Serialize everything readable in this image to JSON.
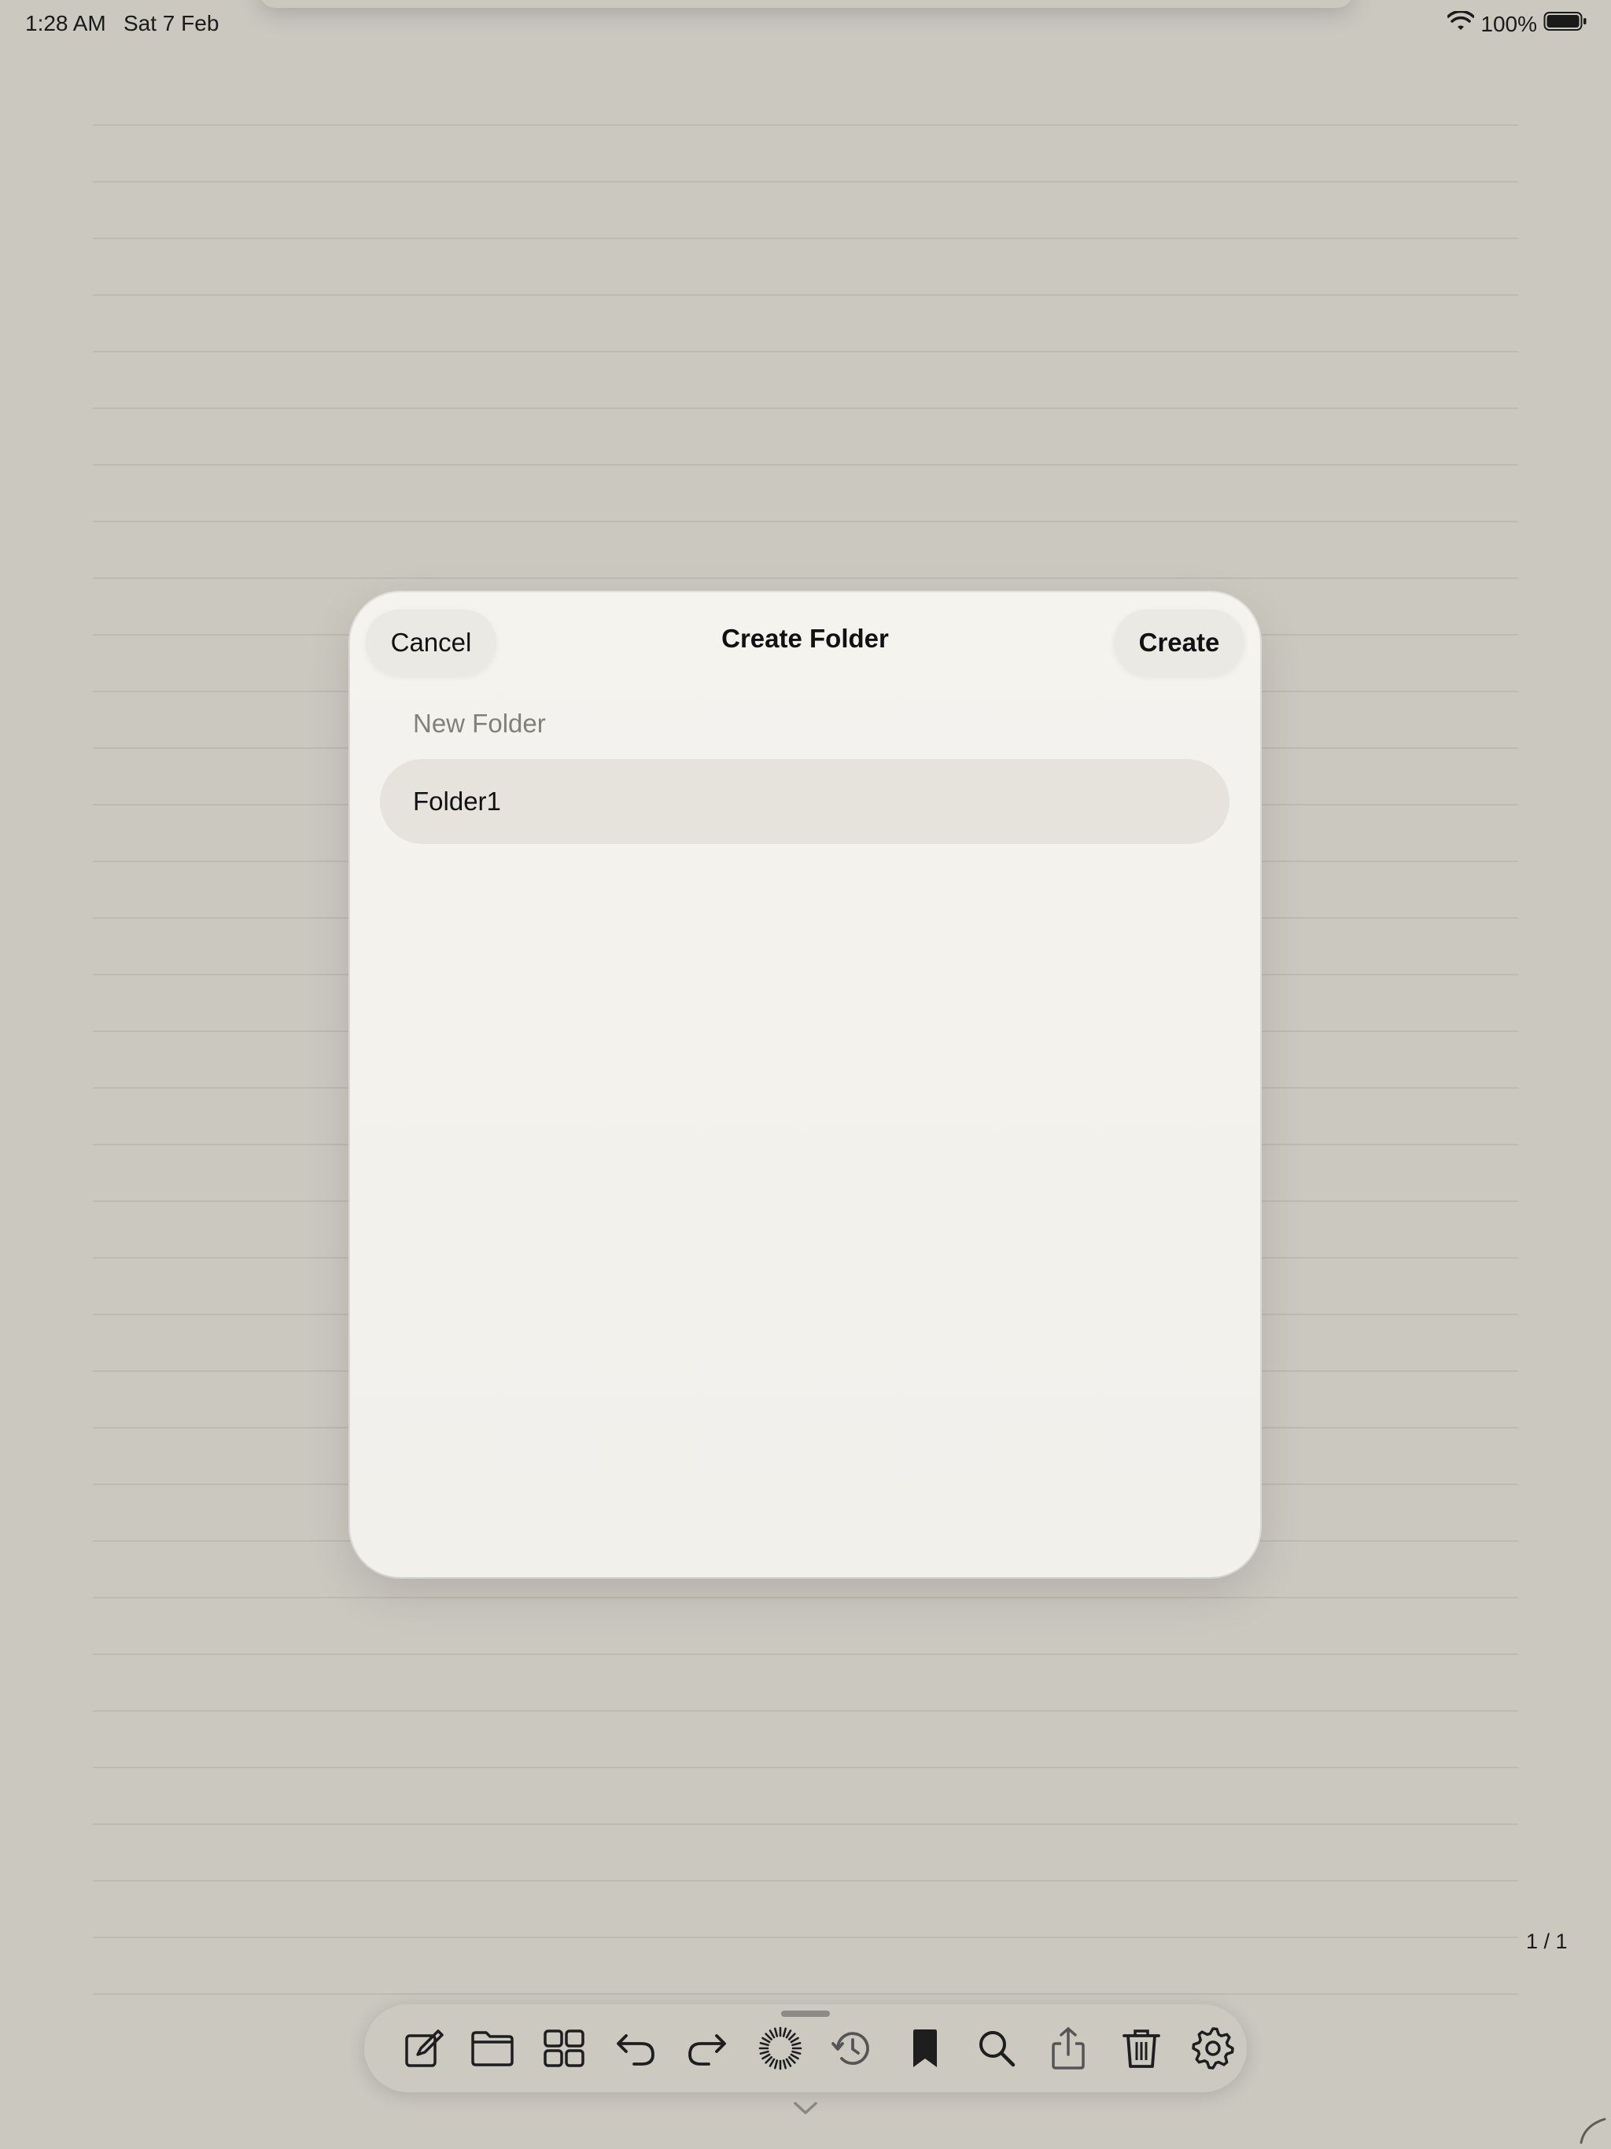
{
  "status_bar": {
    "time": "1:28 AM",
    "date": "Sat 7 Feb",
    "battery": "100%"
  },
  "dialog": {
    "title": "Create Folder",
    "cancel_label": "Cancel",
    "create_label": "Create",
    "section_label": "New Folder",
    "folder_name_value": "Folder1"
  },
  "page_indicator": "1 / 1",
  "toolbar": {
    "icons": [
      "compose-icon",
      "folder-icon",
      "grid-icon",
      "undo-icon",
      "redo-icon",
      "loading-icon",
      "history-icon",
      "bookmark-icon",
      "search-icon",
      "share-icon",
      "trash-icon",
      "settings-icon"
    ]
  }
}
